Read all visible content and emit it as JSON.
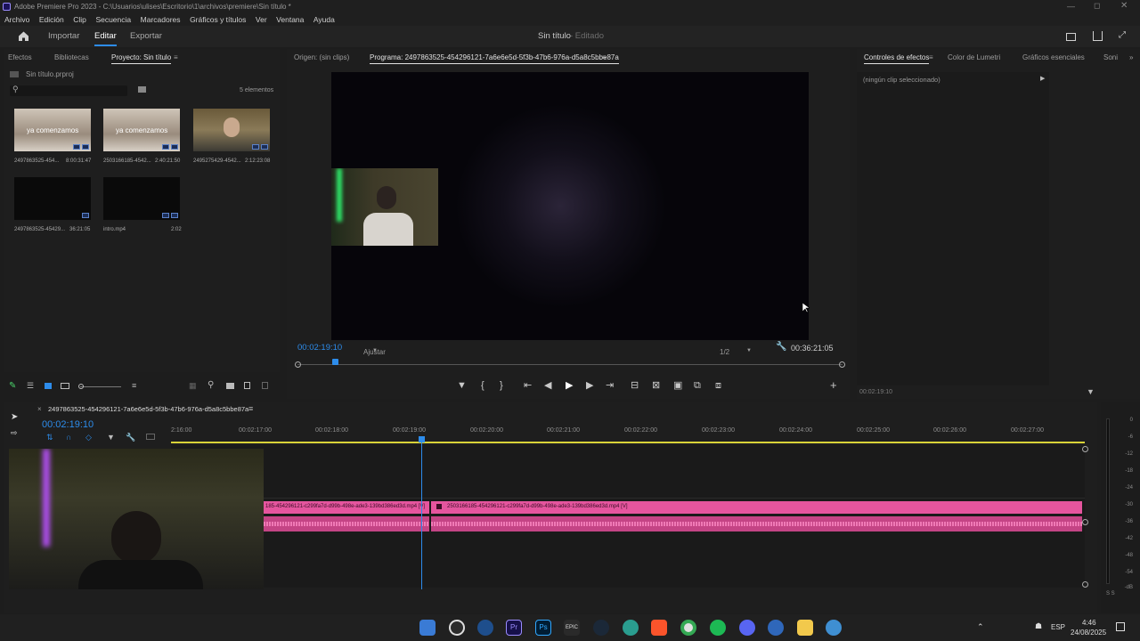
{
  "window_title": "Adobe Premiere Pro 2023 - C:\\Usuarios\\ulises\\Escritorio\\1\\archivos\\premiere\\Sin título *",
  "menu": [
    "Archivo",
    "Edición",
    "Clip",
    "Secuencia",
    "Marcadores",
    "Gráficos y títulos",
    "Ver",
    "Ventana",
    "Ayuda"
  ],
  "workspace": {
    "import": "Importar",
    "edit": "Editar",
    "export": "Exportar",
    "project_name": "Sin título",
    "status": "- Editado"
  },
  "project_panel": {
    "tabs": [
      "Efectos",
      "Bibliotecas",
      "Proyecto: Sin título"
    ],
    "file": "Sin título.prproj",
    "count": "5 elementos",
    "items": [
      {
        "name": "2497863525-454...",
        "duration": "8:00:31:47",
        "overlay": "ya comenzamos"
      },
      {
        "name": "2503166185-4542...",
        "duration": "2:40:21:50",
        "overlay": "ya comenzamos"
      },
      {
        "name": "2495275429-4542...",
        "duration": "2:12:23:08",
        "overlay": ""
      },
      {
        "name": "2497863525-45429...",
        "duration": "36:21:05",
        "overlay": ""
      },
      {
        "name": "intro.mp4",
        "duration": "2:02",
        "overlay": ""
      }
    ]
  },
  "program_monitor": {
    "source_tab": "Origen: (sin clips)",
    "program_tab": "Programa: 2497863525-454296121-7a6e6e5d-5f3b-47b6-976a-d5a8c5bbe87a",
    "current_time": "00:02:19:10",
    "fit": "Ajustar",
    "resolution": "1/2",
    "duration": "00:36:21:05",
    "playhead_fraction": 0.064
  },
  "effects_panel": {
    "tabs": [
      "Controles de efectos",
      "Color de Lumetri",
      "Gráficos esenciales",
      "Soni"
    ],
    "empty": "(ningún clip seleccionado)",
    "time": "00:02:19:10"
  },
  "timeline": {
    "sequence": "2497863525-454296121-7a6e6e5d-5f3b-47b6-976a-d5a8c5bbe87a",
    "current_time": "00:02:19:10",
    "ticks": [
      "2:16:00",
      "00:02:17:00",
      "00:02:18:00",
      "00:02:19:00",
      "00:02:20:00",
      "00:02:21:00",
      "00:02:22:00",
      "00:02:23:00",
      "00:02:24:00",
      "00:02:25:00",
      "00:02:26:00",
      "00:02:27:00"
    ],
    "clip1": "185-454296121-c299fa7d-d99b-498e-ade3-139bd386ed3d.mp4 [V]",
    "clip2": "2503166185-454296121-c299fa7d-d99b-498e-ade3-139bd386ed3d.mp4 [V]"
  },
  "meter": {
    "labels": [
      "0",
      "-6",
      "-12",
      "-18",
      "-24",
      "-30",
      "-36",
      "-42",
      "-48",
      "-54",
      "-dB"
    ],
    "solo": "S S"
  },
  "taskbar": {
    "lang": "ESP",
    "time": "4:46",
    "date": "24/08/2025"
  },
  "colors": {
    "accent": "#2d8ceb",
    "clip_pink": "#e5559e",
    "timeline_yellow": "#d9d238"
  }
}
